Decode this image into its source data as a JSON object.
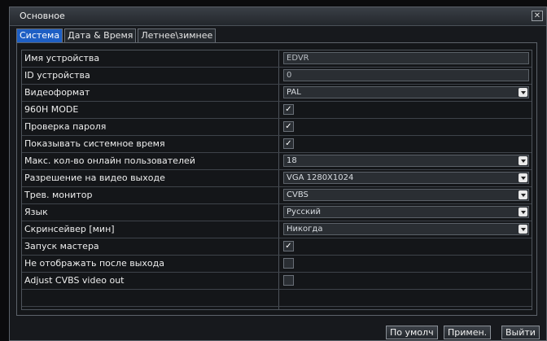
{
  "window": {
    "title": "Основное"
  },
  "tabs": [
    {
      "label": "Система"
    },
    {
      "label": "Дата & Время"
    },
    {
      "label": "Летнее\\зимнее"
    }
  ],
  "rows": [
    {
      "label": "Имя устройства",
      "type": "text",
      "value": "EDVR"
    },
    {
      "label": "ID устройства",
      "type": "text",
      "value": "0"
    },
    {
      "label": "Видеоформат",
      "type": "select",
      "value": "PAL"
    },
    {
      "label": "960H MODE",
      "type": "checkbox",
      "checked": true
    },
    {
      "label": "Проверка пароля",
      "type": "checkbox",
      "checked": true
    },
    {
      "label": "Показывать системное время",
      "type": "checkbox",
      "checked": true
    },
    {
      "label": "Макс. кол-во онлайн пользователей",
      "type": "select",
      "value": "18"
    },
    {
      "label": "Разрешение на видео выходе",
      "type": "select",
      "value": "VGA 1280X1024"
    },
    {
      "label": "Трев. монитор",
      "type": "select",
      "value": "CVBS"
    },
    {
      "label": "Язык",
      "type": "select",
      "value": "Русский"
    },
    {
      "label": "Скринсейвер [мин]",
      "type": "select",
      "value": "Никогда"
    },
    {
      "label": "Запуск мастера",
      "type": "checkbox",
      "checked": true
    },
    {
      "label": "Не отображать после выхода",
      "type": "checkbox",
      "checked": false
    },
    {
      "label": "Adjust CVBS video out",
      "type": "checkbox",
      "checked": false
    }
  ],
  "buttons": {
    "default": "По умолч",
    "apply": "Примен.",
    "exit": "Выйти"
  },
  "icons": {
    "close": "close-icon",
    "check": "check-icon",
    "dropdown": "chevron-down-icon"
  }
}
